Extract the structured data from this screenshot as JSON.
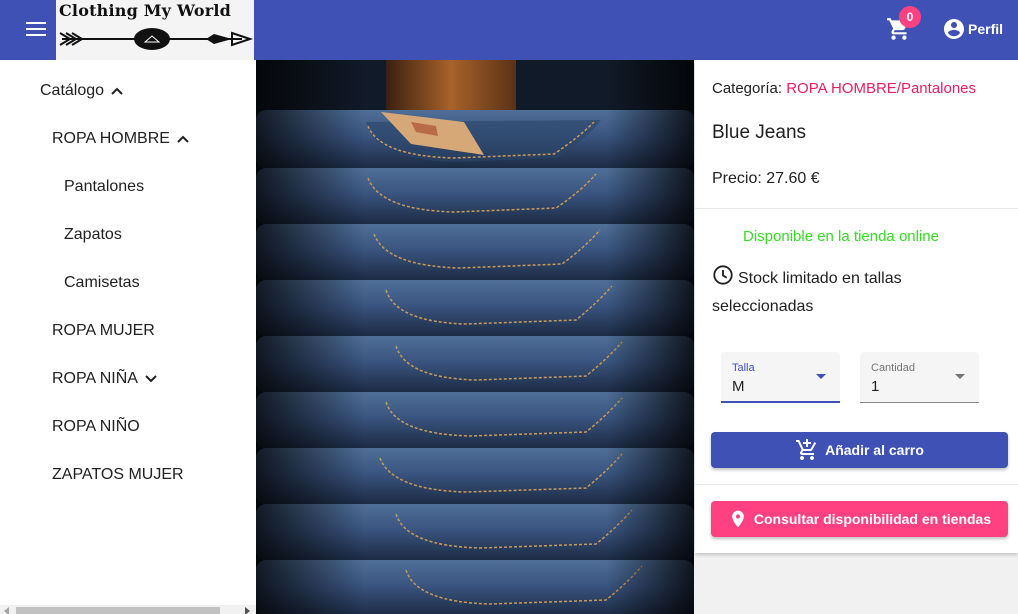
{
  "header": {
    "logo_text": "Clothing My World",
    "cart_count": "0",
    "profile_label": "Perfil"
  },
  "sidebar": {
    "items": [
      {
        "label": "Catálogo"
      },
      {
        "label": "ROPA HOMBRE"
      },
      {
        "label": "Pantalones"
      },
      {
        "label": "Zapatos"
      },
      {
        "label": "Camisetas"
      },
      {
        "label": "ROPA MUJER"
      },
      {
        "label": "ROPA NIÑA"
      },
      {
        "label": "ROPA NIÑO"
      },
      {
        "label": "ZAPATOS MUJER"
      }
    ]
  },
  "product": {
    "category_prefix": "Categoría:",
    "category_path": "ROPA HOMBRE/Pantalones",
    "name": "Blue Jeans",
    "price": "Precio: 27.60 €",
    "availability": "Disponible en la tienda online",
    "stock_note": "Stock limitado en tallas seleccionadas",
    "size_label": "Talla",
    "size_value": "M",
    "quantity_label": "Cantidad",
    "quantity_value": "1",
    "add_to_cart_label": "Añadir al carro",
    "check_stores_label": "Consultar disponibilidad en tiendas"
  },
  "colors": {
    "primary": "#3f51b5",
    "accent": "#ff4081",
    "category_link": "#e91e63",
    "availability": "#33dd22"
  }
}
